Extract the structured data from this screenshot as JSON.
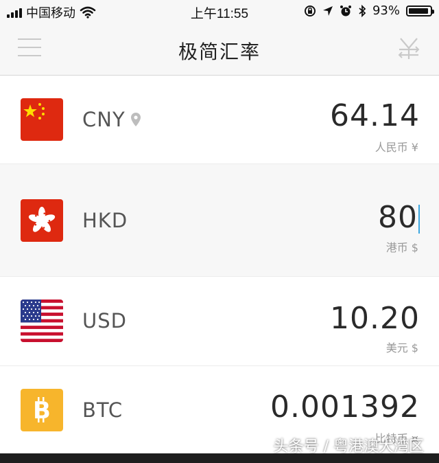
{
  "status_bar": {
    "carrier": "中国移动",
    "time": "上午11:55",
    "battery_percent_label": "93%",
    "battery_level": 0.93,
    "icons": [
      "signal-icon",
      "wifi-icon",
      "rotation-lock-icon",
      "location-icon",
      "alarm-icon",
      "bluetooth-icon",
      "battery-icon"
    ]
  },
  "navbar": {
    "title": "极简汇率",
    "left_icon": "menu-icon",
    "right_icon": "currency-yen-icon"
  },
  "currencies": [
    {
      "code": "CNY",
      "amount": "64.14",
      "unit": "人民币 ¥",
      "flag": "china-flag-icon",
      "has_location_pin": true,
      "active": false
    },
    {
      "code": "HKD",
      "amount": "80",
      "unit": "港币 $",
      "flag": "hong-kong-flag-icon",
      "has_location_pin": false,
      "active": true
    },
    {
      "code": "USD",
      "amount": "10.20",
      "unit": "美元 $",
      "flag": "usa-flag-icon",
      "has_location_pin": false,
      "active": false
    },
    {
      "code": "BTC",
      "amount": "0.001392",
      "unit": "比特币 ¤",
      "flag": "bitcoin-icon",
      "has_location_pin": false,
      "active": false
    }
  ],
  "watermark": "头条号 / 粤港澳大湾区",
  "colors": {
    "background": "#ffffff",
    "active_row": "#f7f7f7",
    "caret": "#3ba7e0",
    "china_red": "#de2910",
    "hk_red": "#de2910",
    "bitcoin_orange": "#f7b52c"
  }
}
